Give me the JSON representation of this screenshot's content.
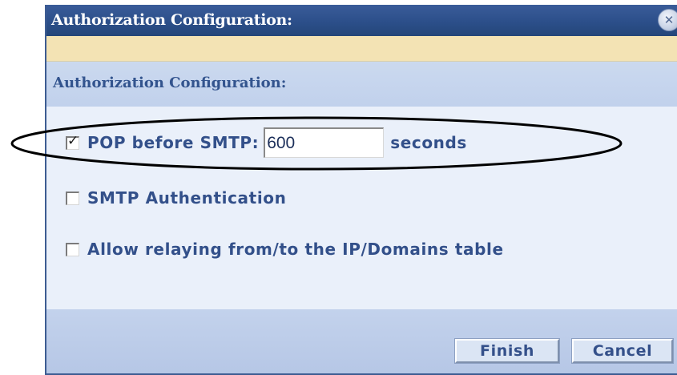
{
  "dialog": {
    "title": "Authorization Configuration:",
    "close_icon": "close-icon"
  },
  "section": {
    "title": "Authorization Configuration:"
  },
  "options": {
    "pop_before_smtp": {
      "checked": true,
      "label": "POP before SMTP:",
      "value": "600",
      "unit": "seconds"
    },
    "smtp_authentication": {
      "checked": false,
      "label": "SMTP Authentication"
    },
    "allow_relaying": {
      "checked": false,
      "label": "Allow relaying from/to the IP/Domains table"
    }
  },
  "buttons": {
    "finish": "Finish",
    "cancel": "Cancel"
  },
  "colors": {
    "titlebar": "#2c4f8a",
    "label": "#33508a",
    "panel": "#eaf0fa",
    "annotation": "#000000"
  }
}
